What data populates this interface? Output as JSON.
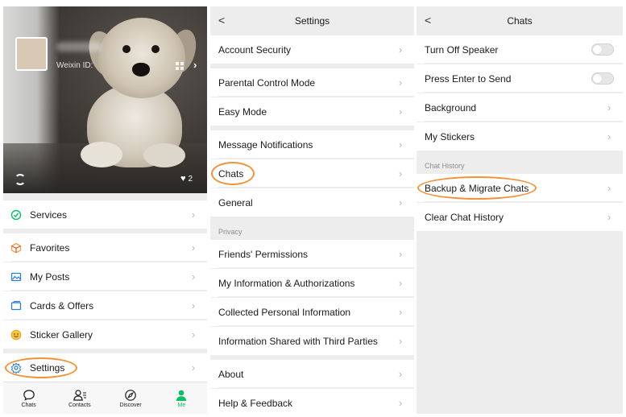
{
  "me": {
    "weixin_id_label": "Weixin ID:",
    "likes_count": "2",
    "items": [
      {
        "label": "Services",
        "icon": "services-icon"
      },
      {
        "label": "Favorites",
        "icon": "favorites-icon"
      },
      {
        "label": "My Posts",
        "icon": "posts-icon"
      },
      {
        "label": "Cards & Offers",
        "icon": "cards-icon"
      },
      {
        "label": "Sticker Gallery",
        "icon": "sticker-icon"
      },
      {
        "label": "Settings",
        "icon": "gear-icon"
      }
    ],
    "tabs": [
      {
        "label": "Chats",
        "icon": "chat-bubble-icon"
      },
      {
        "label": "Contacts",
        "icon": "contacts-icon"
      },
      {
        "label": "Discover",
        "icon": "compass-icon"
      },
      {
        "label": "Me",
        "icon": "person-icon",
        "active": true
      }
    ]
  },
  "settings": {
    "title": "Settings",
    "items": [
      "Account Security",
      "Parental Control Mode",
      "Easy Mode",
      "Message Notifications",
      "Chats",
      "General"
    ],
    "privacy_label": "Privacy",
    "privacy_items": [
      "Friends' Permissions",
      "My Information & Authorizations",
      "Collected Personal Information",
      "Information Shared with Third Parties"
    ],
    "footer_items": [
      "About",
      "Help & Feedback"
    ]
  },
  "chats": {
    "title": "Chats",
    "toggles": [
      {
        "label": "Turn Off Speaker",
        "on": false
      },
      {
        "label": "Press Enter to Send",
        "on": false
      }
    ],
    "items": [
      "Background",
      "My Stickers"
    ],
    "history_label": "Chat History",
    "history_items": [
      "Backup & Migrate Chats",
      "Clear Chat History"
    ]
  },
  "colors": {
    "accent_green": "#07c160",
    "highlight_orange": "#f39236",
    "background": "#ededed"
  }
}
